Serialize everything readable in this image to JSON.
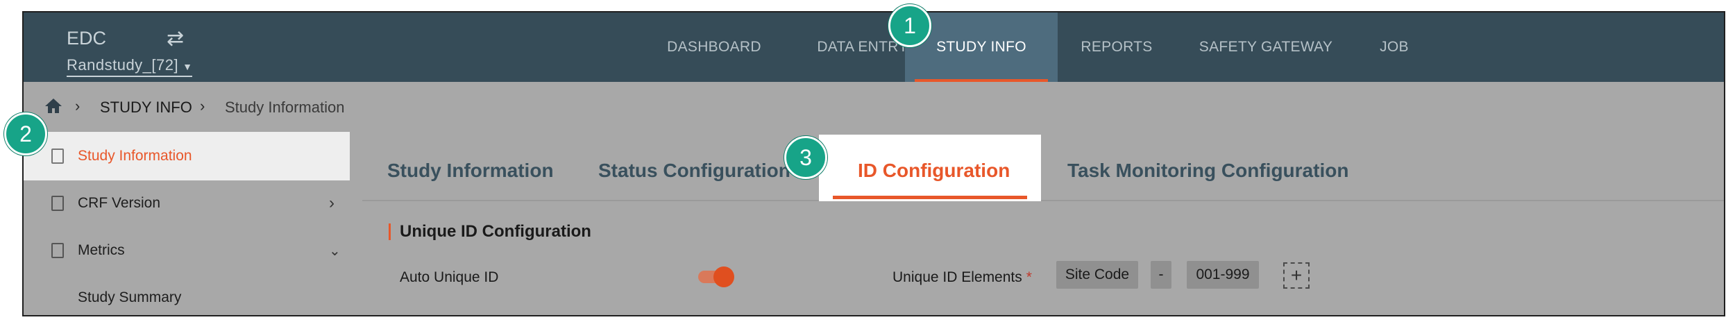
{
  "app": {
    "brand": "EDC",
    "study_selector": "Randstudy_[72]"
  },
  "nav": [
    {
      "label": "DASHBOARD"
    },
    {
      "label": "DATA ENTRY"
    },
    {
      "label": "STUDY INFO"
    },
    {
      "label": "REPORTS"
    },
    {
      "label": "SAFETY GATEWAY"
    },
    {
      "label": "JOB"
    }
  ],
  "nav_active": "STUDY INFO",
  "breadcrumb": {
    "home_icon": "home-icon",
    "items": [
      "STUDY INFO",
      "Study Information"
    ]
  },
  "sidebar": {
    "items": [
      {
        "label": "Study Information",
        "icon": "document-icon",
        "active": true
      },
      {
        "label": "CRF Version",
        "icon": "form-icon",
        "arrow": "chevron-right-icon"
      },
      {
        "label": "Metrics",
        "icon": "metrics-icon",
        "arrow": "chevron-down-icon"
      },
      {
        "label": "Study Summary"
      }
    ]
  },
  "tabs": [
    {
      "label": "Study Information"
    },
    {
      "label": "Status Configuration"
    },
    {
      "label": "ID Configuration",
      "active": true
    },
    {
      "label": "Task Monitoring Configuration"
    }
  ],
  "section": {
    "title": "Unique ID Configuration",
    "auto_unique_id_label": "Auto Unique ID",
    "auto_unique_id_enabled": true,
    "elements_label": "Unique ID Elements",
    "required_mark": "*",
    "elements": [
      "Site Code",
      "-",
      "001-999"
    ],
    "add_button": "+"
  },
  "callouts": [
    "1",
    "2",
    "3"
  ],
  "colors": {
    "topbar": "#364c58",
    "accent": "#e8572a",
    "callout": "#17a488"
  }
}
